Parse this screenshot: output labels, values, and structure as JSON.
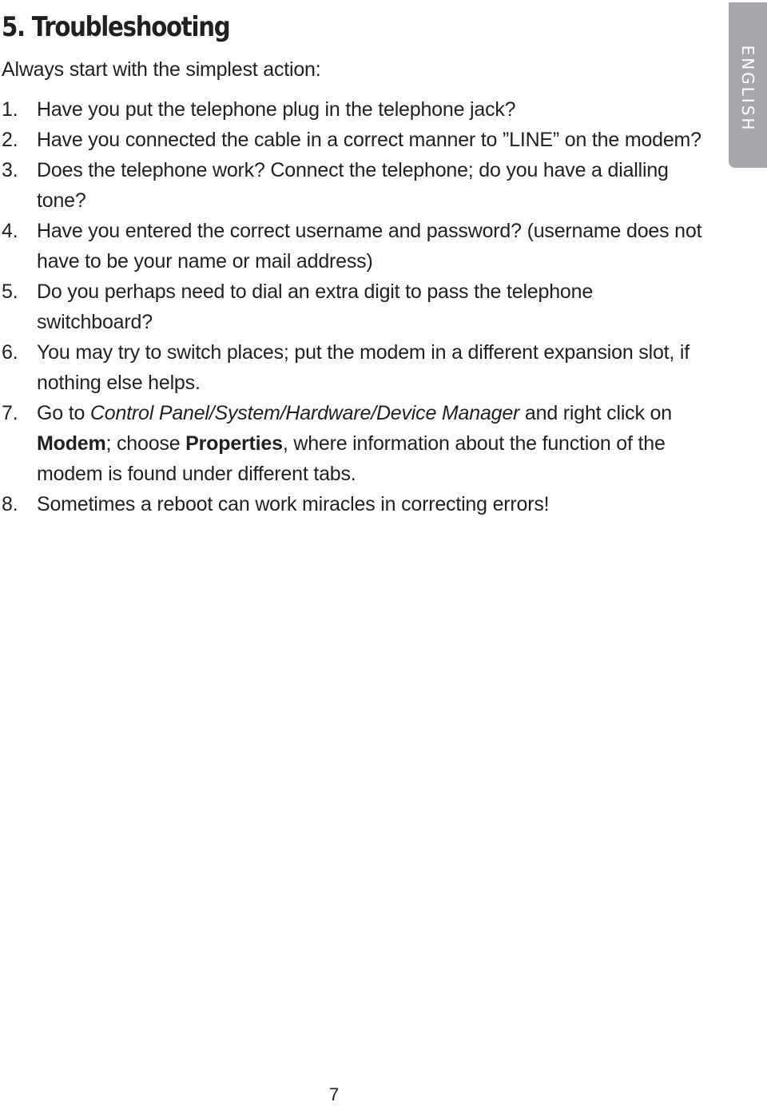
{
  "heading": "5. Troubleshooting",
  "intro": "Always start with the simplest action:",
  "steps": [
    {
      "num": "1.",
      "text": "Have you put the telephone plug in the telephone jack?"
    },
    {
      "num": "2.",
      "text": "Have you connected the cable in a correct manner to ”LINE” on the modem?"
    },
    {
      "num": "3.",
      "text": "Does the telephone work? Connect the telephone; do you have a dialling tone?"
    },
    {
      "num": "4.",
      "text": "Have you entered the correct username and password? (username does not have to be your name or mail address)"
    },
    {
      "num": "5.",
      "text": "Do you perhaps need to dial an extra digit to pass the telephone switchboard?"
    },
    {
      "num": "6.",
      "text": "You may try to switch places; put the modem in a different expansion slot, if nothing else helps."
    },
    {
      "num": "7.",
      "parts": {
        "a": "Go to ",
        "path": "Control Panel/System/Hardware/Device Manager",
        "b": " and right click on ",
        "modem": "Modem",
        "c": "; choose ",
        "properties": "Properties",
        "d": ", where information about the function of the modem is found under different tabs."
      }
    },
    {
      "num": "8.",
      "text": "Sometimes a reboot can work miracles in correcting errors!"
    }
  ],
  "language_tab": "ENGLISH",
  "page_number": "7",
  "colors": {
    "text": "#231f20",
    "tab": "#a7a8ab"
  }
}
